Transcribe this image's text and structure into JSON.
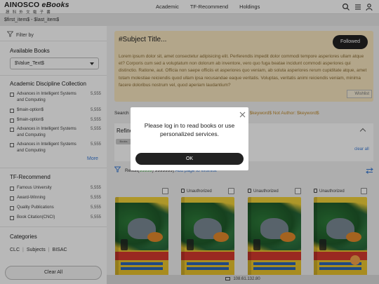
{
  "header": {
    "logo_main": "AINOSCO",
    "logo_ebooks": "eBooks",
    "logo_sub": "昂科外文電子書",
    "nav": [
      "Academic",
      "TF-Recommend",
      "Holdings"
    ],
    "icons": [
      "search-icon",
      "list-icon",
      "user-icon"
    ]
  },
  "breadcrumb": "$first_item$ - $last_item$",
  "sidebar": {
    "filter_by": "Filter by",
    "available_books_title": "Available Books",
    "available_books_value": "$Value_Text$",
    "discipline_title": "Academic Discipline Collection",
    "discipline_items": [
      {
        "label": "Advances in Intelligent Systems and Computing",
        "count": "5,555"
      },
      {
        "label": "$main-option$",
        "count": "5,555"
      },
      {
        "label": "$main-option$",
        "count": "5,555"
      },
      {
        "label": "Advances in Intelligent Systems and Computing",
        "count": "5,555"
      },
      {
        "label": "Advances in Intelligent Systems and Computing",
        "count": "5,555"
      }
    ],
    "more": "More",
    "tf_title": "TF-Recommend",
    "tf_items": [
      {
        "label": "Famous University",
        "count": "5,555"
      },
      {
        "label": "Award-Winning",
        "count": "5,555"
      },
      {
        "label": "Quality Publications",
        "count": "5,555"
      },
      {
        "label": "Book Citation(CNCI)",
        "count": "5,555"
      }
    ],
    "categories_title": "Categories",
    "category_tabs": [
      "CLC",
      "|",
      "Subjects",
      "|",
      "BISAC"
    ],
    "clear_all": "Clear All"
  },
  "subject": {
    "title": "#Subject Title...",
    "followed": "Followed",
    "description": "Lorem ipsum dolor sit, amet consectetur adipisicing elit. Perferendis impedit dolor commodi tempore asperiores ullam atque et? Corporis cum sed a voluptatum non dolorum ab inventore, vero quo fuga beatae incidunt commodi asperiores qui distinctio. Ratione, aut. Officia non saepe officiis et asperiores quo veniam, ab soluta asperiores rerum cupiditate atque, amet totam molestiae reiciendis quod ullam ipsa recusandae eaque veritatis. Voluptas, veritatis animi reiciendis veniam, minima facere doloribus nostrum vel, quod aperiam laudantium?",
    "wishlist": "Wishlist"
  },
  "search_row": {
    "prefix": "Search",
    "text": "ublisher: $keyword$ Not Author: $keyword$"
  },
  "refine": {
    "title": "Refine",
    "chip": "Books",
    "clear_all": "clear all"
  },
  "result": {
    "prefix": "Result(",
    "num": "99999",
    "suffix": ") 9999999) ",
    "link": "Add page to Wishlist"
  },
  "books": [
    {
      "status": "",
      "has_lock": false
    },
    {
      "status": "Unauthorized",
      "has_lock": true
    },
    {
      "status": "Unauthorized",
      "has_lock": true
    },
    {
      "status": "Unauthorized",
      "has_lock": true
    }
  ],
  "footer": {
    "ip": "108.61.132.80"
  },
  "modal": {
    "message": "Please log in to read books or use personalized services.",
    "ok": "OK"
  },
  "colors": {
    "accent": "#222222",
    "subject_bg": "#f8e6bf",
    "link": "#3a7bd5"
  }
}
